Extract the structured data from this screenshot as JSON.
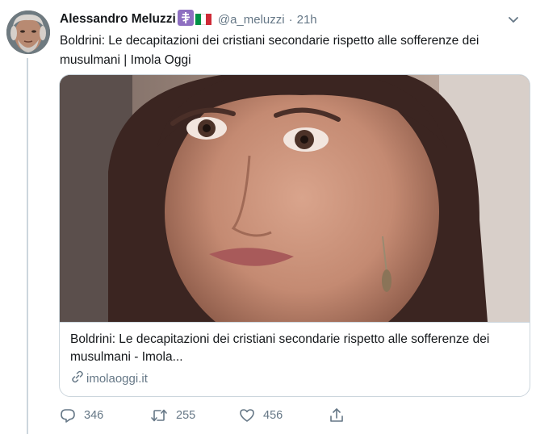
{
  "tweet": {
    "author_name": "Alessandro Meluzzi",
    "handle": "@a_meluzzi",
    "separator": "·",
    "time": "21h",
    "text": "Boldrini: Le decapitazioni dei cristiani secondarie rispetto alle sofferenze dei musulmani | Imola Oggi"
  },
  "card": {
    "title": "Boldrini: Le decapitazioni dei cristiani secondarie rispetto alle sofferenze dei musulmani - Imola...",
    "domain": "imolaoggi.it"
  },
  "actions": {
    "reply_count": "346",
    "retweet_count": "255",
    "like_count": "456"
  },
  "colors": {
    "text_primary": "#14171a",
    "text_secondary": "#657786",
    "border": "#ccd6dd",
    "badge_purple": "#8e6fc1",
    "flag_green": "#009246",
    "flag_white": "#ffffff",
    "flag_red": "#ce2b37"
  },
  "icons": [
    "more-chevron-icon",
    "reply-icon",
    "retweet-icon",
    "like-icon",
    "share-icon",
    "link-icon",
    "cross-badge-icon",
    "italy-flag-icon"
  ]
}
